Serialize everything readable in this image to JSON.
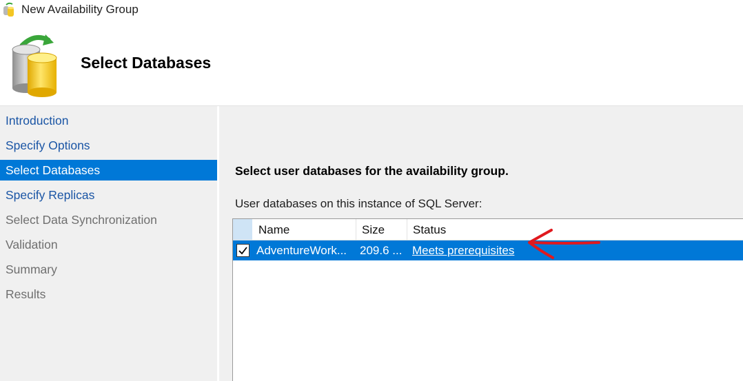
{
  "window": {
    "title": "New Availability Group"
  },
  "header": {
    "title": "Select Databases"
  },
  "nav": {
    "items": [
      {
        "label": "Introduction",
        "state": "link"
      },
      {
        "label": "Specify Options",
        "state": "link"
      },
      {
        "label": "Select Databases",
        "state": "active"
      },
      {
        "label": "Specify Replicas",
        "state": "link"
      },
      {
        "label": "Select Data Synchronization",
        "state": "disabled"
      },
      {
        "label": "Validation",
        "state": "disabled"
      },
      {
        "label": "Summary",
        "state": "disabled"
      },
      {
        "label": "Results",
        "state": "disabled"
      }
    ]
  },
  "main": {
    "instruction": "Select user databases for the availability group.",
    "grid_label": "User databases on this instance of SQL Server:",
    "columns": [
      "Name",
      "Size",
      "Status"
    ],
    "rows": [
      {
        "checked": true,
        "name": "AdventureWork...",
        "size": "209.6 ...",
        "status": "Meets prerequisites"
      }
    ]
  },
  "colors": {
    "accent": "#0078d7",
    "link": "#1a55a5",
    "annotation": "#e0191e"
  }
}
